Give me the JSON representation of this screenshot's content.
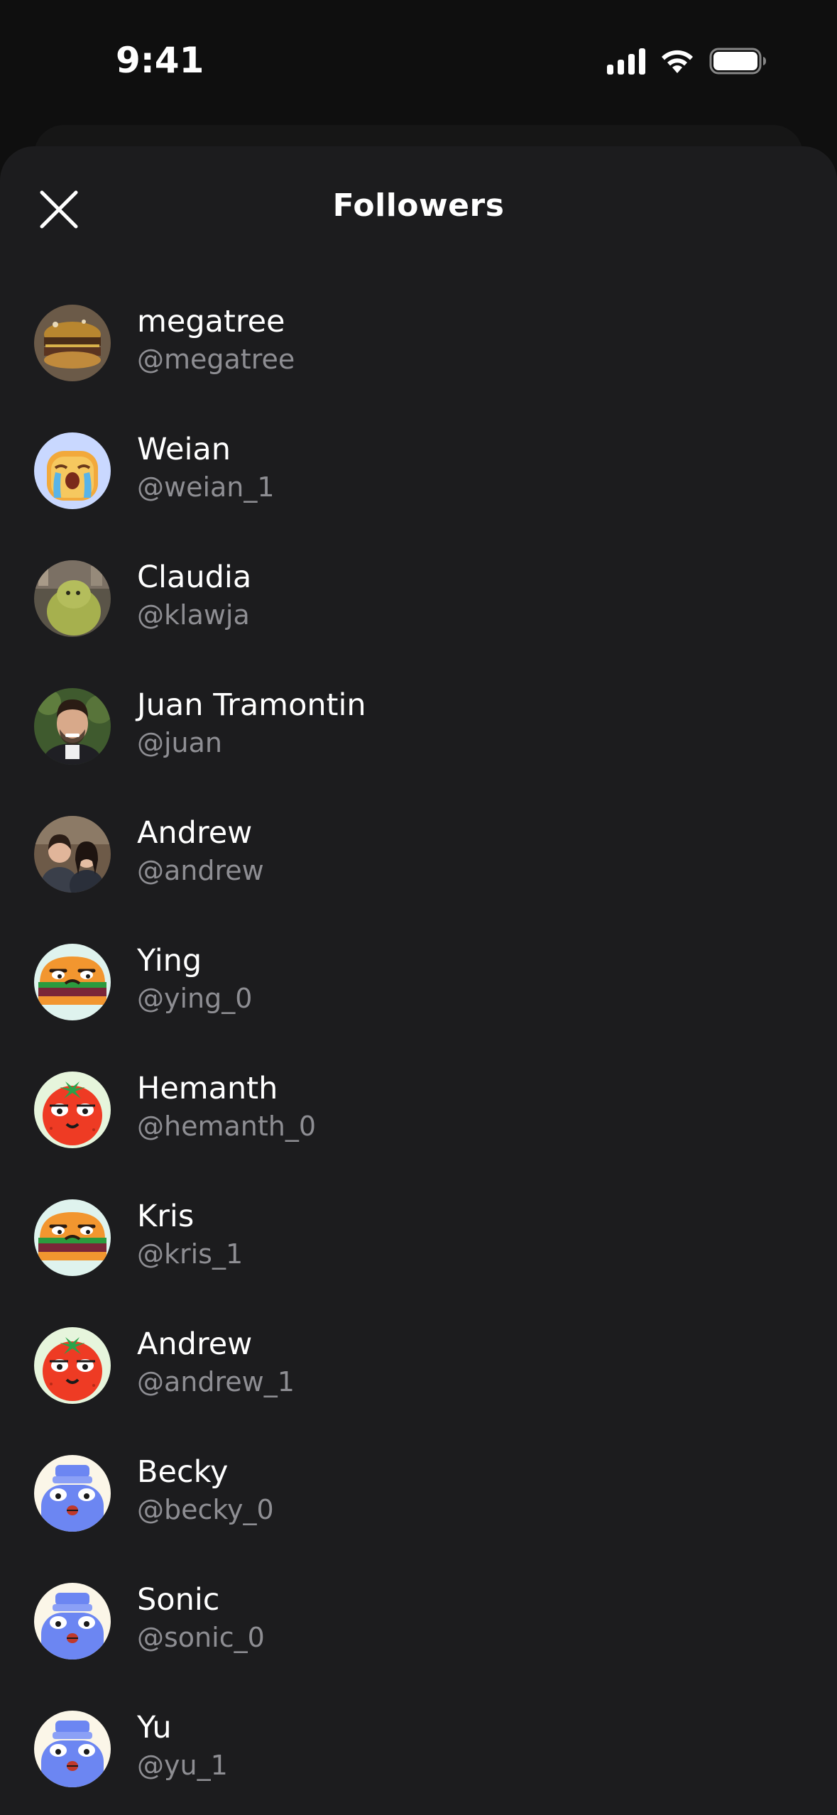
{
  "status_bar": {
    "time": "9:41"
  },
  "header": {
    "title": "Followers"
  },
  "followers": [
    {
      "name": "megatree",
      "handle": "@megatree",
      "avatar": "photo-burger"
    },
    {
      "name": "Weian",
      "handle": "@weian_1",
      "avatar": "toast-emoji"
    },
    {
      "name": "Claudia",
      "handle": "@klawja",
      "avatar": "photo-plush"
    },
    {
      "name": "Juan Tramontin",
      "handle": "@juan",
      "avatar": "photo-person"
    },
    {
      "name": "Andrew",
      "handle": "@andrew",
      "avatar": "photo-couple"
    },
    {
      "name": "Ying",
      "handle": "@ying_0",
      "avatar": "burger-character"
    },
    {
      "name": "Hemanth",
      "handle": "@hemanth_0",
      "avatar": "tomato-character"
    },
    {
      "name": "Kris",
      "handle": "@kris_1",
      "avatar": "burger-character"
    },
    {
      "name": "Andrew",
      "handle": "@andrew_1",
      "avatar": "tomato-character"
    },
    {
      "name": "Becky",
      "handle": "@becky_0",
      "avatar": "jar-character"
    },
    {
      "name": "Sonic",
      "handle": "@sonic_0",
      "avatar": "jar-character"
    },
    {
      "name": "Yu",
      "handle": "@yu_1",
      "avatar": "jar-character"
    }
  ]
}
